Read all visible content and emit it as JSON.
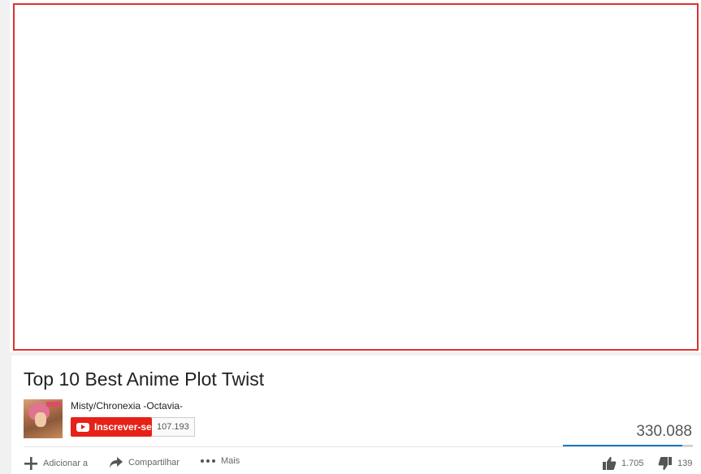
{
  "video": {
    "title": "Top 10 Best Anime Plot Twist",
    "view_count": "330.088"
  },
  "channel": {
    "name": "Misty/Chronexia -Octavia-",
    "subscribe_label": "Inscrever-se",
    "subscriber_count": "107.193"
  },
  "actions": {
    "add_label": "Adicionar a",
    "share_label": "Compartilhar",
    "more_label": "Mais",
    "likes": "1.705",
    "dislikes": "139"
  },
  "sentiment": {
    "like_fraction": 0.92
  },
  "icons": {
    "add": "plus-icon",
    "share": "share-arrow-icon",
    "more": "more-dots-icon",
    "like": "thumbs-up-icon",
    "dislike": "thumbs-down-icon",
    "subscribe": "youtube-logo-icon"
  },
  "colors": {
    "subscribe_red": "#e62117",
    "sentiment_blue": "#167ac6",
    "player_border": "#e03030"
  }
}
